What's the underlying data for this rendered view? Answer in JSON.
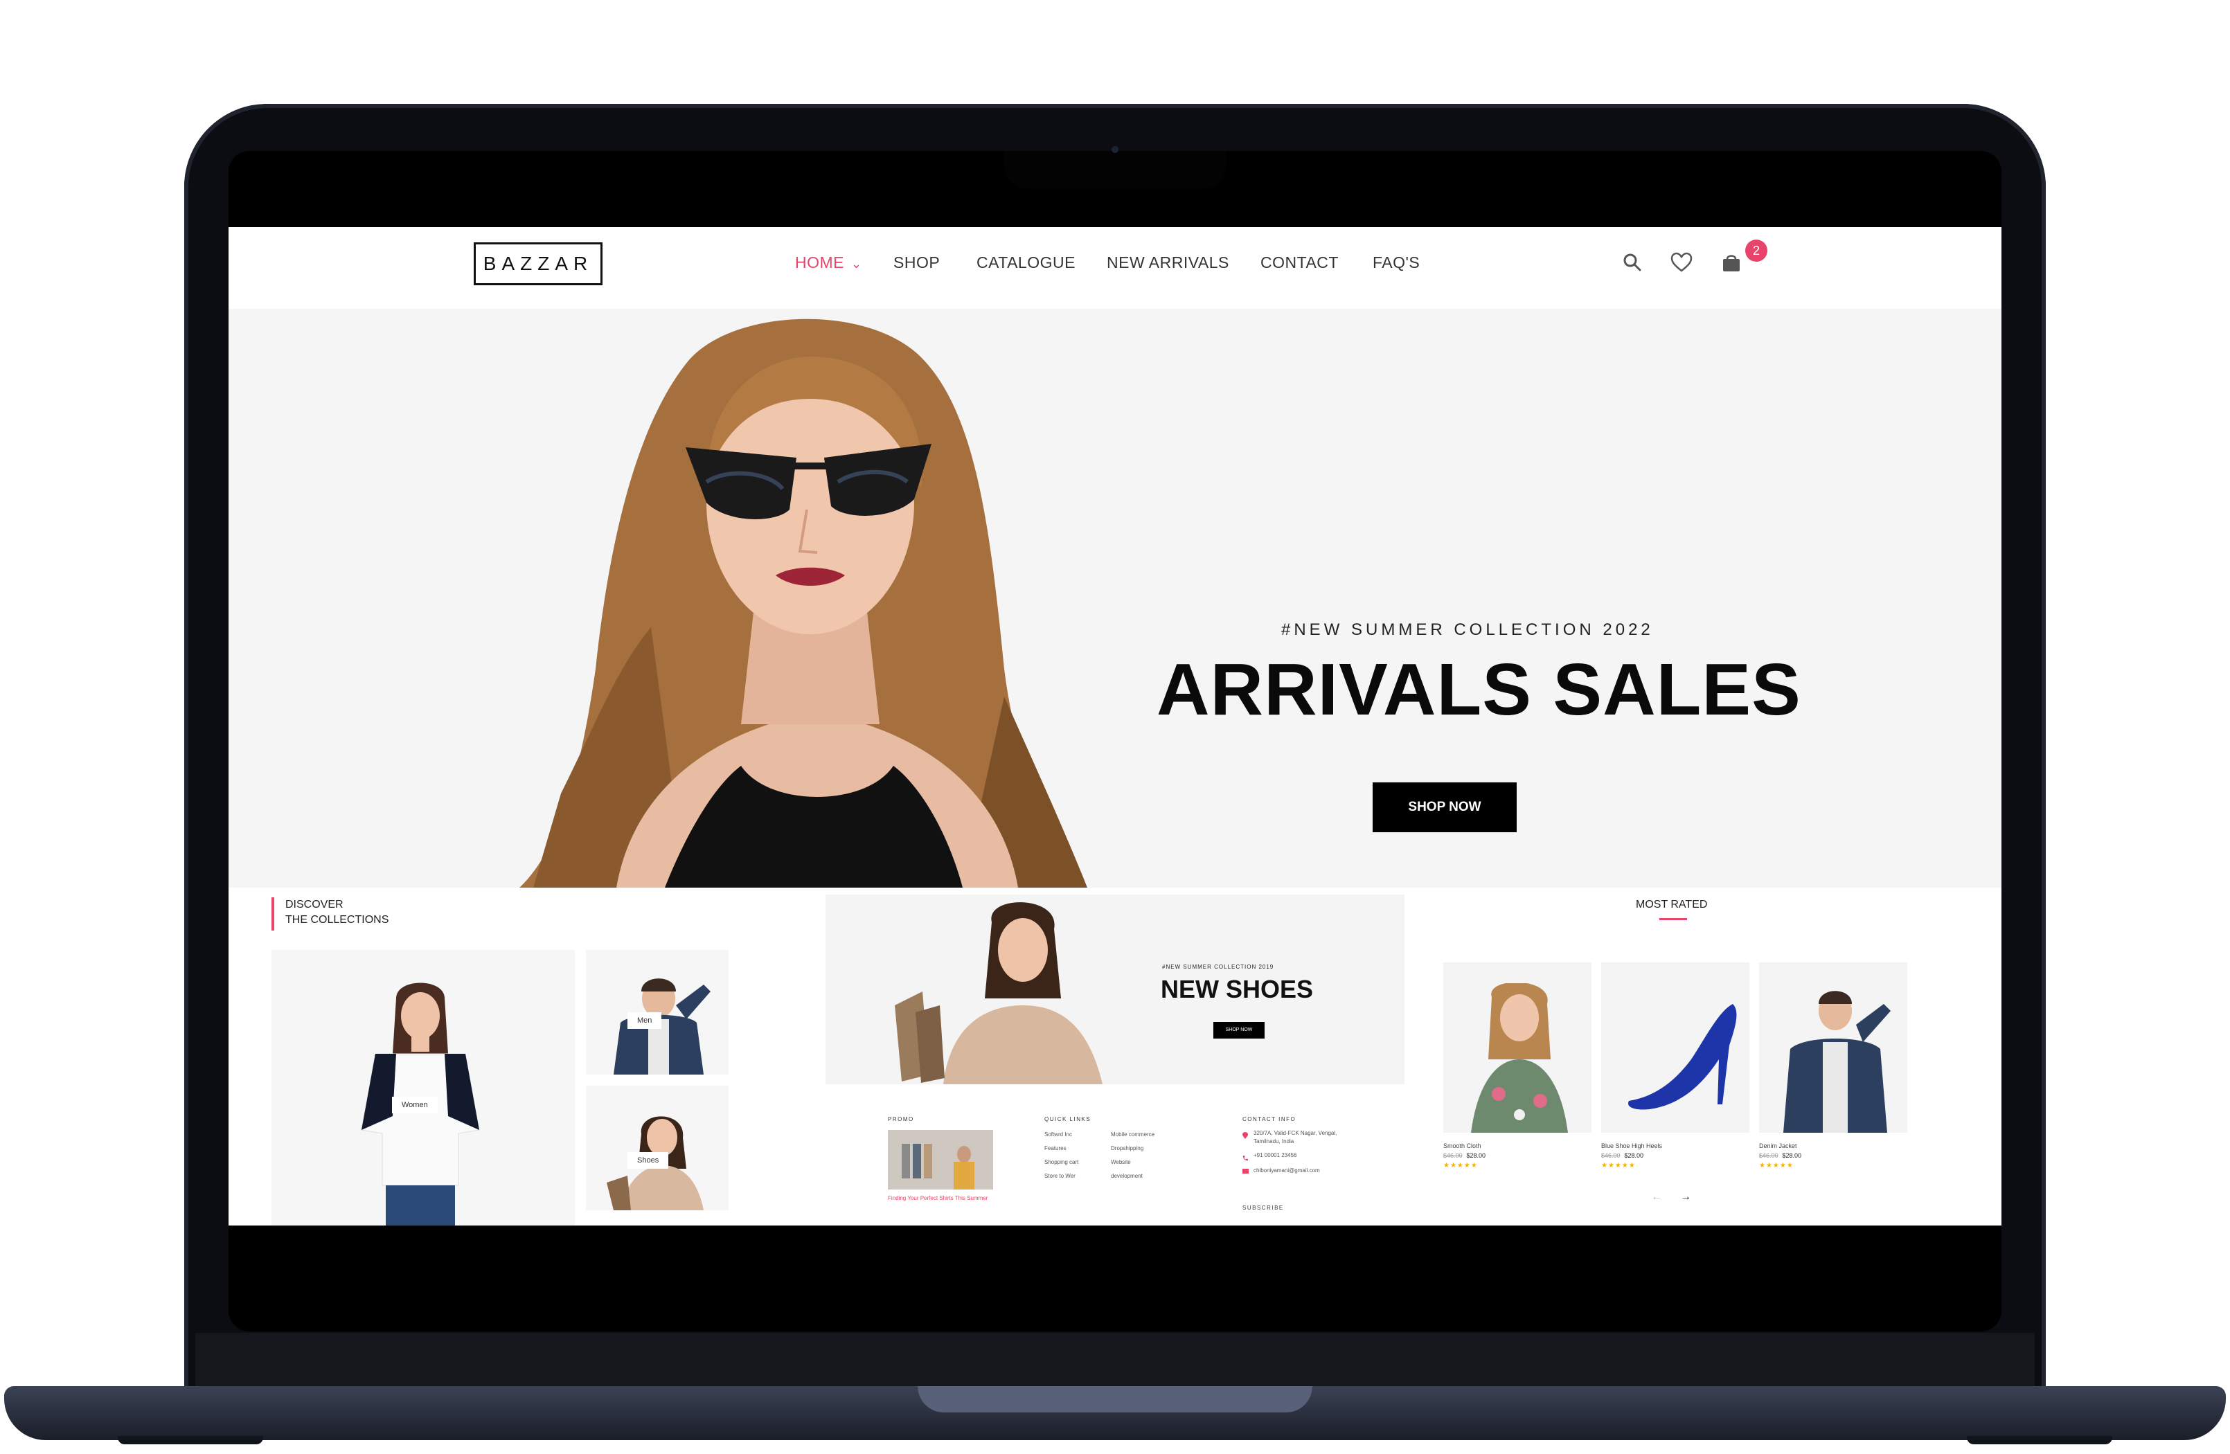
{
  "brand": {
    "logo": "BAZZAR",
    "accent": "#e8436a"
  },
  "nav": {
    "items": [
      {
        "label": "HOME",
        "active": true
      },
      {
        "label": "SHOP"
      },
      {
        "label": "CATALOGUE"
      },
      {
        "label": "NEW ARRIVALS"
      },
      {
        "label": "CONTACT"
      },
      {
        "label": "FAQ'S"
      }
    ],
    "icons": [
      "search-icon",
      "heart-icon",
      "cart-icon"
    ],
    "cart_count": "2"
  },
  "hero": {
    "subtitle": "#NEW SUMMER COLLECTION 2022",
    "title": "ARRIVALS SALES",
    "button": "SHOP NOW"
  },
  "collections": {
    "heading_line1": "DISCOVER",
    "heading_line2": "THE COLLECTIONS",
    "cards": [
      {
        "label": "Women"
      },
      {
        "label": "Men"
      },
      {
        "label": "Shoes"
      }
    ]
  },
  "shoes_banner": {
    "subtitle": "#NEW SUMMER COLLECTION 2019",
    "title": "NEW SHOES",
    "button": "SHOP NOW"
  },
  "footer": {
    "promo_heading": "PROMO",
    "promo_caption": "Finding Your Perfect Shirts This Summer",
    "quick_links_heading": "QUICK LINKS",
    "quick_links_col1": [
      "Softwrd Inc",
      "Features",
      "Shopping cart",
      "Store to Wer"
    ],
    "quick_links_col2": [
      "Mobile commerce",
      "Dropshipping",
      "Website",
      "development"
    ],
    "contact_heading": "CONTACT INFO",
    "contact_address_line1": "320/7A, Valid-FCK Nagar, Vengal,",
    "contact_address_line2": "Tamilnadu, India",
    "contact_phone": "+91 00001 23456",
    "contact_email": "chiboniyamani@gmail.com",
    "subscribe_heading": "SUBSCRIBE"
  },
  "most_rated": {
    "heading": "MOST RATED",
    "products": [
      {
        "name": "Smooth Cloth",
        "old_price": "$46.00",
        "price": "$28.00",
        "rating": 5
      },
      {
        "name": "Blue Shoe High Heels",
        "old_price": "$46.00",
        "price": "$28.00",
        "rating": 5
      },
      {
        "name": "Denim Jacket",
        "old_price": "$46.00",
        "price": "$28.00",
        "rating": 5
      }
    ]
  }
}
